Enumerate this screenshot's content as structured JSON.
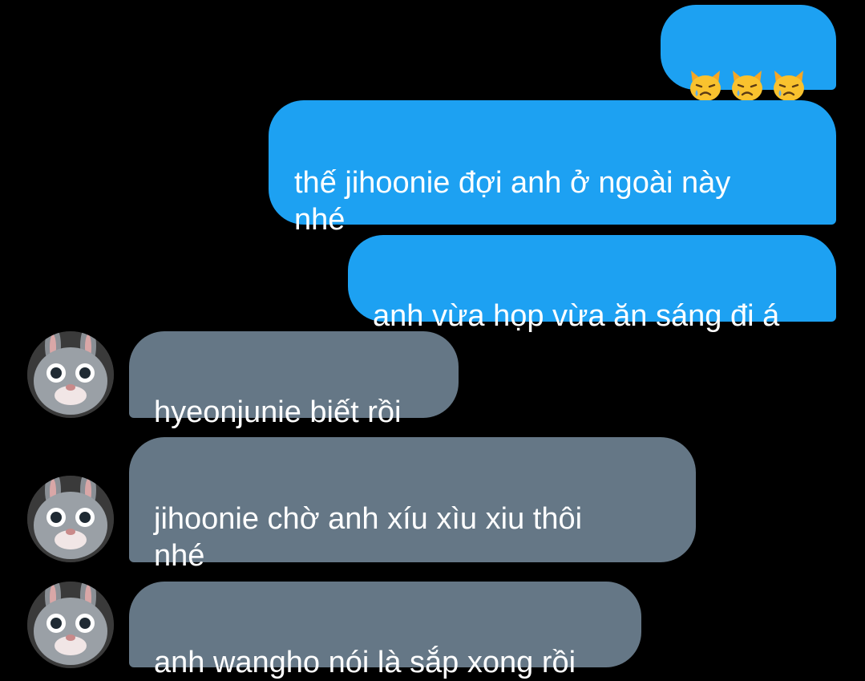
{
  "colors": {
    "background": "#000000",
    "outgoing_bubble": "#1da1f2",
    "incoming_bubble": "#657786",
    "text": "#ffffff"
  },
  "messages": [
    {
      "direction": "outgoing",
      "type": "emoji",
      "icons": [
        "crying-cat-icon",
        "crying-cat-icon",
        "crying-cat-icon"
      ]
    },
    {
      "direction": "outgoing",
      "text": "thế jihoonie đợi anh ở ngoài này\nnhé"
    },
    {
      "direction": "outgoing",
      "text": "anh vừa họp vừa ăn sáng đi á"
    },
    {
      "direction": "incoming",
      "text": "hyeonjunie biết rồi",
      "avatar": "bunny-avatar"
    },
    {
      "direction": "incoming",
      "text": "jihoonie chờ anh xíu xìu xiu thôi\nnhé",
      "avatar": "bunny-avatar"
    },
    {
      "direction": "incoming",
      "text": "anh wangho nói là sắp xong rồi",
      "avatar": "bunny-avatar"
    }
  ]
}
